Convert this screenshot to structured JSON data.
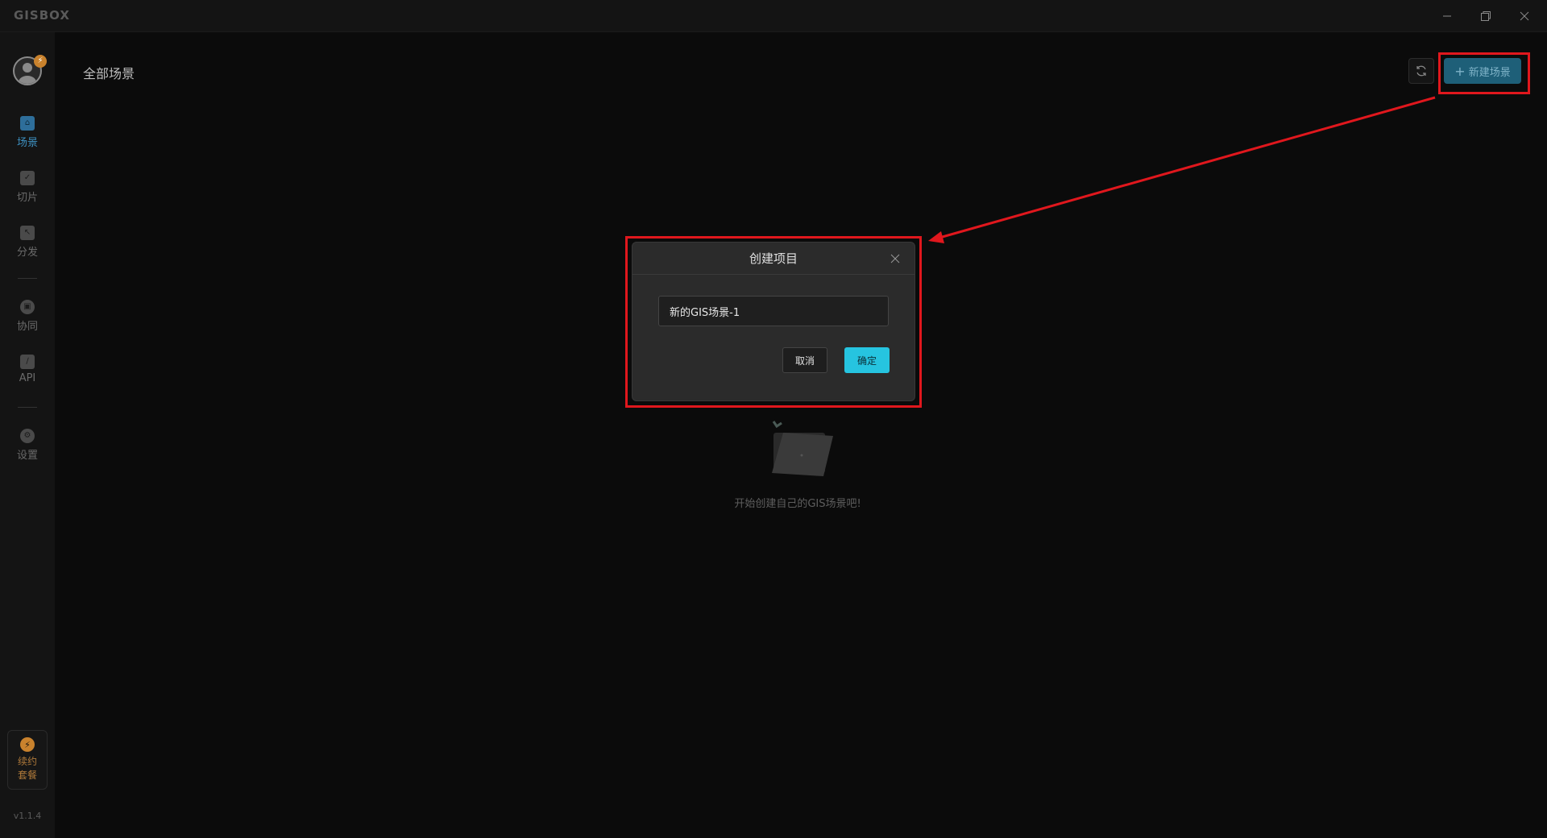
{
  "app": {
    "logo_text": "GISBOX"
  },
  "window_controls": {
    "minimize": "−",
    "maximize": "❐",
    "close": "✕"
  },
  "sidebar": {
    "items": [
      {
        "label": "场景",
        "icon": "home-icon",
        "active": true
      },
      {
        "label": "切片",
        "icon": "file-check-icon",
        "active": false
      },
      {
        "label": "分发",
        "icon": "export-icon",
        "active": false
      },
      {
        "label": "协同",
        "icon": "lock-icon",
        "active": false
      },
      {
        "label": "API",
        "icon": "link-icon",
        "active": false
      },
      {
        "label": "设置",
        "icon": "gear-icon",
        "active": false
      }
    ],
    "renew_label": "续约套餐",
    "version": "v1.1.4"
  },
  "header": {
    "title": "全部场景",
    "refresh_icon": "refresh-icon",
    "new_button_label": "新建场景"
  },
  "empty_state": {
    "icon": "empty-folder-icon",
    "text": "开始创建自己的GIS场景吧!"
  },
  "modal": {
    "title": "创建项目",
    "input_value": "新的GIS场景-1",
    "cancel_label": "取消",
    "confirm_label": "确定"
  },
  "colors": {
    "accent": "#26c4e0",
    "annotation": "#e0171d",
    "brand_orange": "#c9822d"
  }
}
